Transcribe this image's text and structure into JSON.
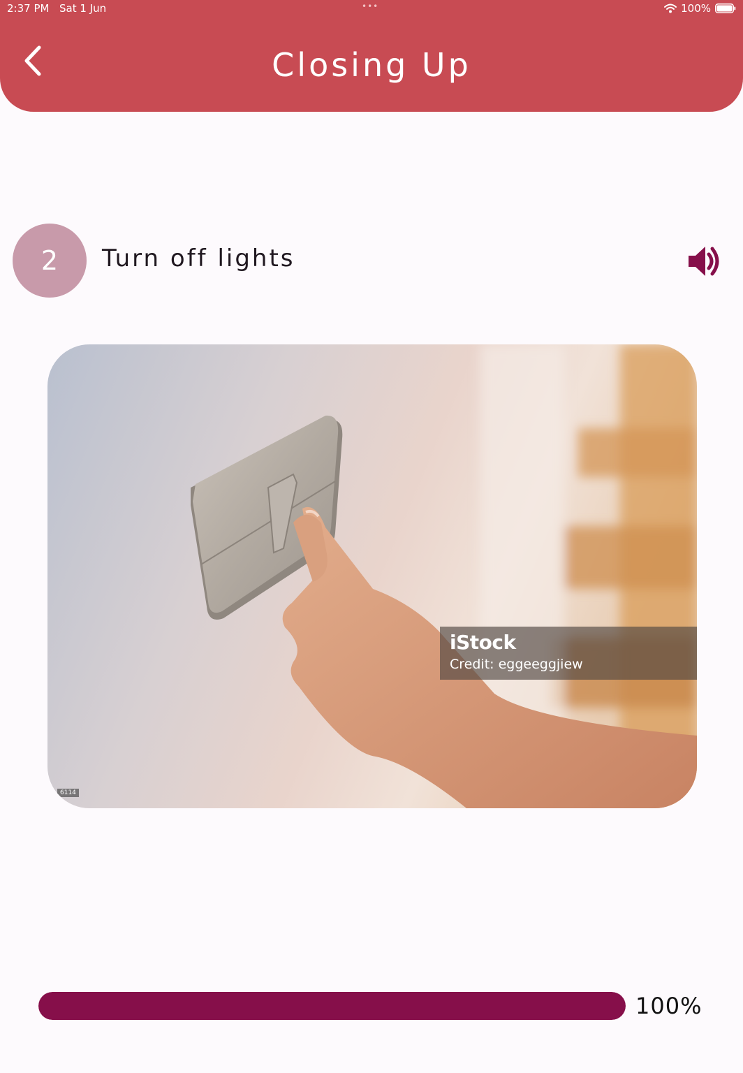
{
  "status_bar": {
    "time": "2:37 PM",
    "date": "Sat 1 Jun",
    "dots": "•••",
    "battery": "100%"
  },
  "header": {
    "title": "Closing Up",
    "back_icon": "chevron-left-icon"
  },
  "step": {
    "number": "2",
    "title": "Turn off lights",
    "speaker_icon": "speaker-icon"
  },
  "image": {
    "watermark_brand": "iStock",
    "watermark_credit": "Credit: eggeeggjiew",
    "id_tag": "6114"
  },
  "progress": {
    "value": 1.0,
    "label": "100%"
  },
  "colors": {
    "header": "#c84b53",
    "accent": "#860f4a",
    "step_circle": "#c89aaa",
    "background": "#fdfafd"
  }
}
